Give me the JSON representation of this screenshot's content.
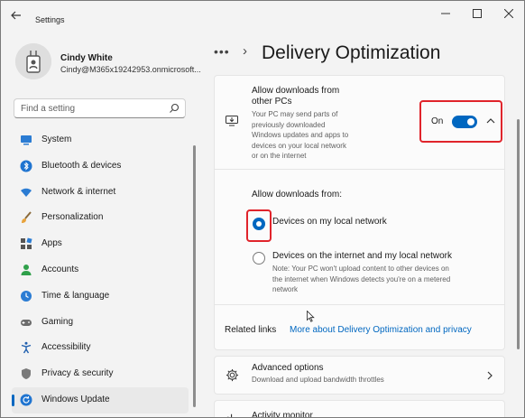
{
  "window": {
    "app_title": "Settings",
    "controls": {
      "minimize": "—",
      "maximize": "☐",
      "close": "✕"
    }
  },
  "profile": {
    "name": "Cindy White",
    "email": "Cindy@M365x19242953.onmicrosoft..."
  },
  "search": {
    "placeholder": "Find a setting",
    "icon": "search-icon"
  },
  "sidebar": {
    "items": [
      {
        "label": "System",
        "icon": "monitor-icon",
        "selected": false
      },
      {
        "label": "Bluetooth & devices",
        "icon": "bluetooth-icon",
        "selected": false
      },
      {
        "label": "Network & internet",
        "icon": "wifi-icon",
        "selected": false
      },
      {
        "label": "Personalization",
        "icon": "brush-icon",
        "selected": false
      },
      {
        "label": "Apps",
        "icon": "apps-icon",
        "selected": false
      },
      {
        "label": "Accounts",
        "icon": "person-icon",
        "selected": false
      },
      {
        "label": "Time & language",
        "icon": "clock-globe-icon",
        "selected": false
      },
      {
        "label": "Gaming",
        "icon": "gamepad-icon",
        "selected": false
      },
      {
        "label": "Accessibility",
        "icon": "accessibility-icon",
        "selected": false
      },
      {
        "label": "Privacy & security",
        "icon": "shield-icon",
        "selected": false
      },
      {
        "label": "Windows Update",
        "icon": "windows-update-icon",
        "selected": true
      }
    ]
  },
  "header": {
    "breadcrumb_more": "•••",
    "separator": "›",
    "title": "Delivery Optimization"
  },
  "allow_downloads": {
    "title_line1": "Allow downloads from",
    "title_line2": "other PCs",
    "desc_lines": [
      "Your PC may send parts of",
      "previously downloaded",
      "Windows updates and apps to",
      "devices on your local network",
      "or on the internet"
    ],
    "toggle_label": "On",
    "toggle_on": true
  },
  "allow_from": {
    "heading": "Allow downloads from:",
    "options": [
      {
        "label": "Devices on my local network",
        "selected": true,
        "note_lines": []
      },
      {
        "label": "Devices on the internet and my local network",
        "selected": false,
        "note_lines": [
          "Note: Your PC won't upload content to other devices on",
          "the internet when Windows detects you're on a metered",
          "network"
        ]
      }
    ]
  },
  "related": {
    "label": "Related links",
    "link": "More about Delivery Optimization and privacy"
  },
  "advanced": {
    "title": "Advanced options",
    "desc": "Download and upload bandwidth throttles"
  },
  "activity": {
    "title": "Activity monitor"
  },
  "colors": {
    "accent": "#0067c0",
    "highlight": "#e0242b"
  }
}
